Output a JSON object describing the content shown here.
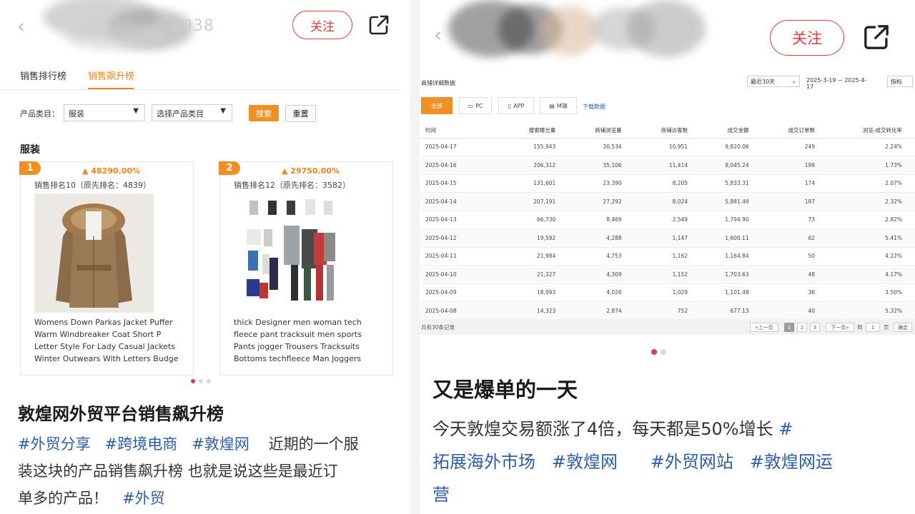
{
  "left": {
    "follow_label": "关注",
    "tabs": [
      {
        "label": "销售排行榜"
      },
      {
        "label": "销售飙升榜"
      }
    ],
    "filter": {
      "label": "产品类目：",
      "category_value": "服装",
      "sub_placeholder": "选择产品类目",
      "search_label": "搜索",
      "reset_label": "重置"
    },
    "section_title": "服装",
    "products": [
      {
        "rank": "1",
        "growth": "48290.00%",
        "rank_info": "销售排名10（原先排名：4839）",
        "title": "Womens Down Parkas Jacket Puffer Warm Windbreaker Coat Short P Letter Style For Lady Casual Jackets Winter Outwears With Letters Budge"
      },
      {
        "rank": "2",
        "growth": "29750.00%",
        "rank_info": "销售排名12（原先排名：3582）",
        "title": "thick Designer men woman tech fleece pant tracksuit men sports Pants jogger Trousers Tracksuits Bottoms techfleece Man Joggers"
      }
    ],
    "post": {
      "title": "敦煌网外贸平台销售飙升榜",
      "tag1": "#外贸分享",
      "tag2": "#跨境电商",
      "tag3": "#敦煌网",
      "text1": "近期的一个服",
      "text2": "装这块的产品销售飙升榜  也就是说这些是最近订",
      "text3": "单多的产品！",
      "tag4": "#外贸"
    }
  },
  "right": {
    "follow_label": "关注",
    "dashboard": {
      "title": "商铺详细数据",
      "range_select": "最近30天",
      "date_range": "2025-3-19 ~ 2025-4-17",
      "metric_select": "指标",
      "segments": [
        {
          "label": "全部"
        },
        {
          "label": "PC"
        },
        {
          "label": "APP"
        },
        {
          "label": "M端"
        }
      ],
      "download_label": "下载数据",
      "columns": [
        "时间",
        "搜索曝光量",
        "商铺浏览量",
        "商铺访客数",
        "成交金额",
        "成交订单数",
        "浏览-成交转化率"
      ],
      "rows": [
        [
          "2025-04-17",
          "155,943",
          "30,534",
          "10,951",
          "9,820.06",
          "249",
          "2.24%"
        ],
        [
          "2025-04-16",
          "206,312",
          "35,106",
          "11,414",
          "8,045.24",
          "199",
          "1.73%"
        ],
        [
          "2025-04-15",
          "131,601",
          "23,390",
          "8,205",
          "5,833.31",
          "174",
          "2.07%"
        ],
        [
          "2025-04-14",
          "207,191",
          "27,292",
          "8,024",
          "5,881.49",
          "187",
          "2.32%"
        ],
        [
          "2025-04-13",
          "66,730",
          "8,469",
          "2,549",
          "1,794.90",
          "73",
          "2.82%"
        ],
        [
          "2025-04-12",
          "19,592",
          "4,288",
          "1,147",
          "1,600.11",
          "62",
          "5.41%"
        ],
        [
          "2025-04-11",
          "21,984",
          "4,753",
          "1,162",
          "1,164.84",
          "50",
          "4.22%"
        ],
        [
          "2025-04-10",
          "21,327",
          "4,309",
          "1,152",
          "1,703.63",
          "48",
          "4.17%"
        ],
        [
          "2025-04-09",
          "18,993",
          "4,026",
          "1,029",
          "1,101.48",
          "36",
          "3.50%"
        ],
        [
          "2025-04-08",
          "14,323",
          "2,874",
          "752",
          "677.13",
          "40",
          "5.32%"
        ]
      ],
      "footer": {
        "total": "共有30条记录",
        "prev": "«上一页",
        "pages": [
          "1",
          "2",
          "3"
        ],
        "next": "下一页»",
        "goto": "到",
        "page_input": "1",
        "page_unit": "页",
        "confirm": "确定"
      }
    },
    "post": {
      "title": "又是爆单的一天",
      "line1": "今天敦煌交易额涨了4倍，每天都是50%增长",
      "tag1": "#",
      "tag1b": "拓展海外市场",
      "tag2": "#敦煌网",
      "tag3": "#外贸网站",
      "tag4": "#敦煌网运",
      "tag4b": "营"
    }
  },
  "colors": {
    "accent_orange": "#f19022",
    "follow_red": "#e63b3b",
    "tag_blue": "#2b5ea8",
    "dot_active": "#e8344b"
  }
}
